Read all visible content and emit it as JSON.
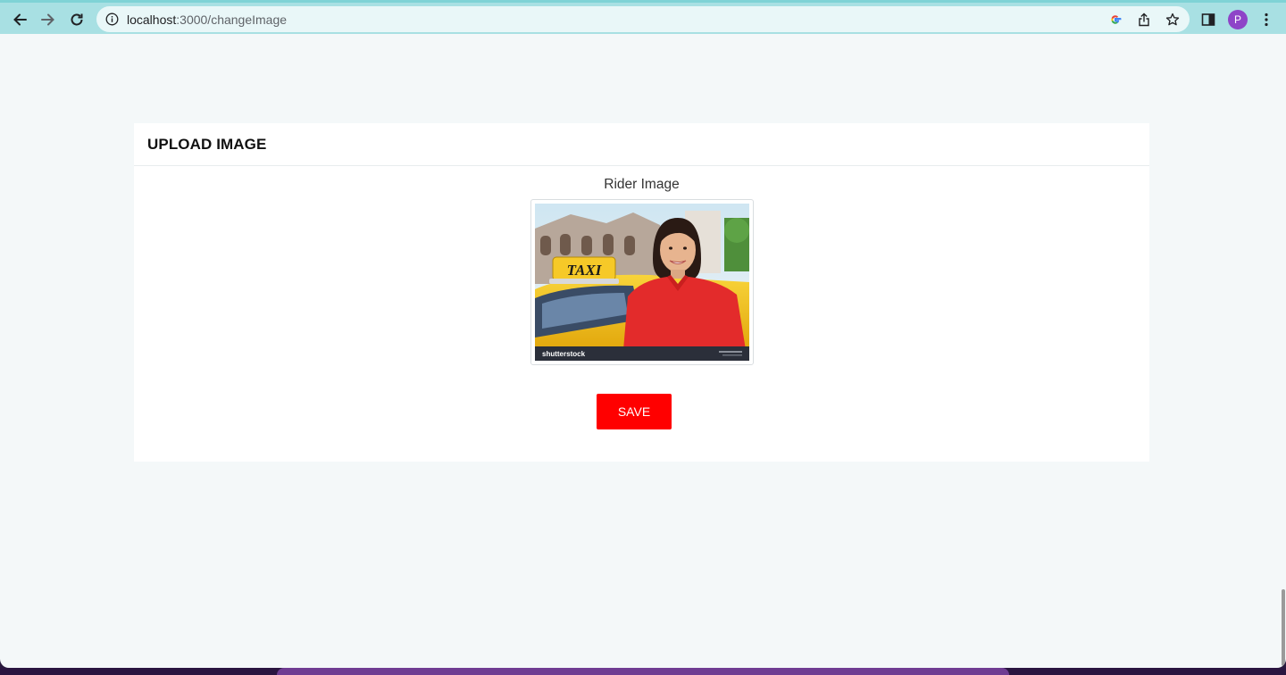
{
  "browser": {
    "url_host": "localhost",
    "url_path": ":3000/changeImage",
    "profile_initial": "P",
    "icons": [
      "back-icon",
      "forward-icon",
      "reload-icon",
      "info-icon",
      "google-icon",
      "share-icon",
      "star-icon",
      "side-panel-icon",
      "menu-icon"
    ]
  },
  "page": {
    "title": "UPLOAD IMAGE",
    "field_label": "Rider Image",
    "image": {
      "sign_text": "TAXI",
      "watermark": "shutterstock"
    },
    "save_label": "SAVE"
  },
  "colors": {
    "chrome": "#a8e0e3",
    "save_button": "#ff0000",
    "page_background": "#f4f8f9"
  }
}
